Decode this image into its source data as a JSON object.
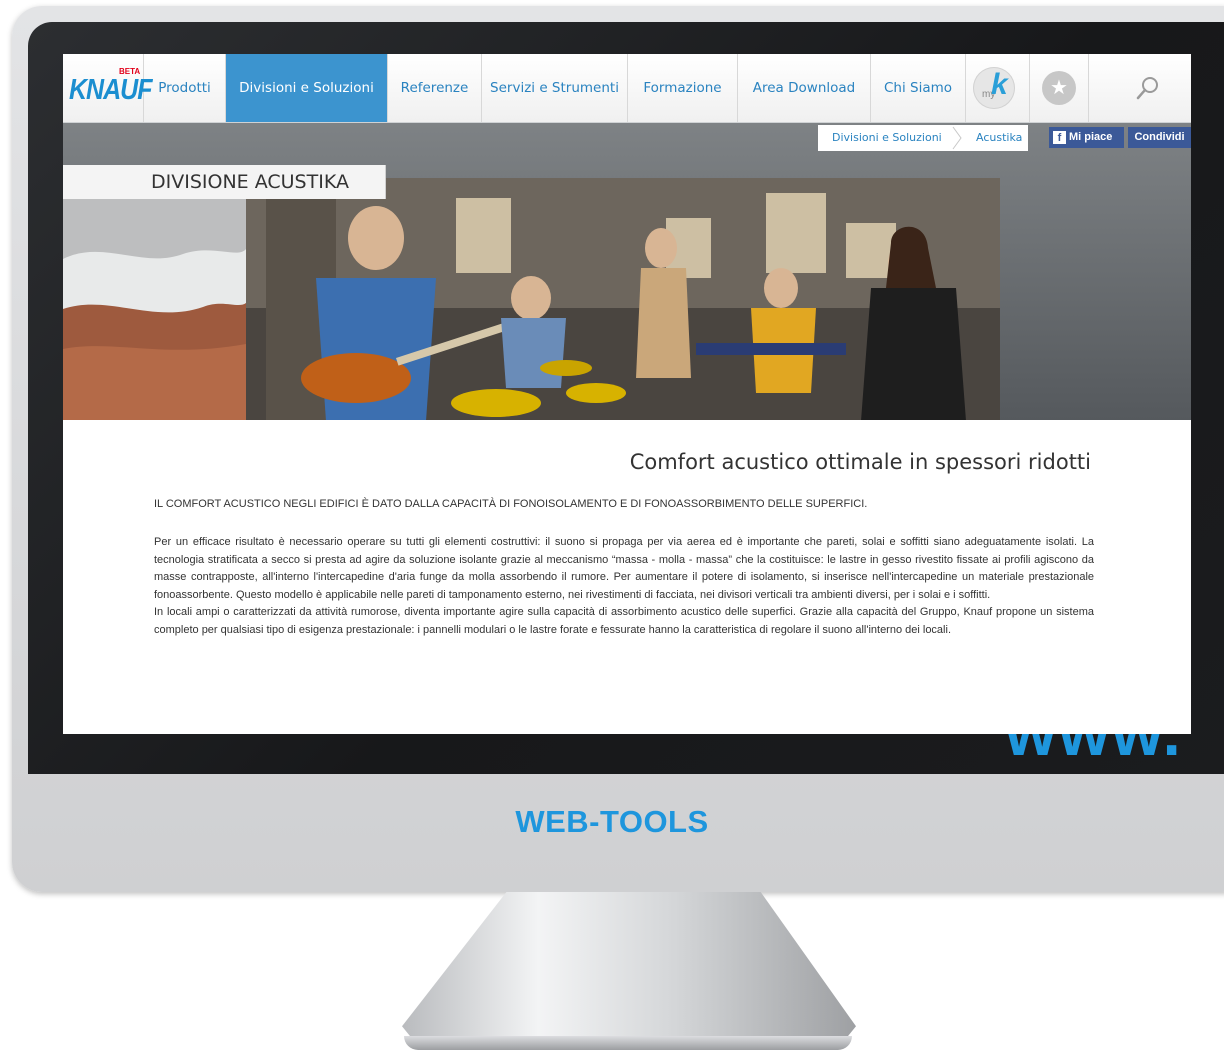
{
  "nav": {
    "logo": "KNAUF",
    "logo_badge": "BETA",
    "items": [
      {
        "label": "Prodotti"
      },
      {
        "label": "Divisioni e Soluzioni",
        "active": true
      },
      {
        "label": "Referenze"
      },
      {
        "label": "Servizi e Strumenti"
      },
      {
        "label": "Formazione"
      },
      {
        "label": "Area Download"
      },
      {
        "label": "Chi Siamo"
      }
    ],
    "myk_my": "my",
    "myk_k": "k",
    "favorites_icon": "star-icon",
    "search_icon": "search-icon"
  },
  "breadcrumb": {
    "items": [
      "Divisioni e Soluzioni",
      "Acustika"
    ]
  },
  "social": {
    "like_icon": "f",
    "like_label": "Mi piace",
    "share_label": "Condividi"
  },
  "hero": {
    "title": "DIVISIONE ACUSTIKA"
  },
  "content": {
    "heading": "Comfort acustico ottimale in spessori ridotti",
    "lead": "IL COMFORT ACUSTICO NEGLI EDIFICI È DATO DALLA CAPACITÀ DI FONOISOLAMENTO E DI FONOASSORBIMENTO DELLE SUPERFICI.",
    "paragraph_1": "Per un efficace risultato è necessario operare su tutti gli elementi costruttivi: il suono si propaga per via aerea ed è importante che pareti, solai e soffitti siano adeguatamente isolati. La tecnologia stratificata a secco si presta ad agire da soluzione isolante grazie al meccanismo “massa - molla - massa” che la costituisce: le lastre in gesso rivestito fissate ai profili agiscono da masse contrapposte, all'interno l'intercapedine d'aria funge da molla assorbendo il rumore. Per aumentare il potere di isolamento, si inserisce nell'intercapedine un materiale prestazionale fonoassorbente. Questo modello è applicabile nelle pareti di tamponamento esterno, nei rivestimenti di facciata, nei divisori verticali tra ambienti diversi, per i solai e i soffitti.",
    "paragraph_2": "In locali ampi o caratterizzati da attività rumorose, diventa importante agire sulla capacità di assorbimento acustico delle superfici. Grazie alla capacità del Gruppo, Knauf propone un sistema completo per qualsiasi tipo di esigenza prestazionale: i pannelli modulari o le lastre forate e fessurate hanno la caratteristica di regolare il suono all'interno dei locali."
  },
  "branding": {
    "chin_label": "WEB-TOOLS",
    "corner_text": "www.",
    "accent_color": "#1e96dd"
  }
}
